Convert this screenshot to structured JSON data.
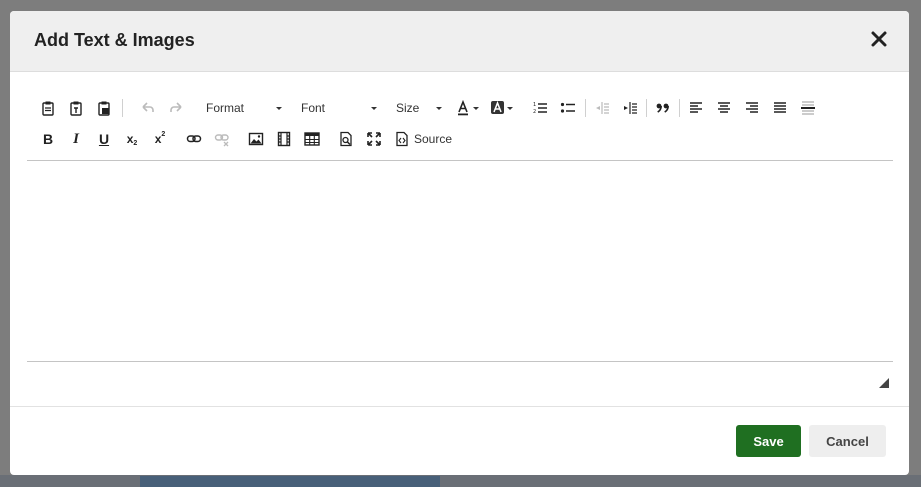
{
  "dialog": {
    "title": "Add Text & Images",
    "close_icon": "close-icon"
  },
  "toolbar": {
    "format_label": "Format",
    "font_label": "Font",
    "size_label": "Size",
    "source_label": "Source",
    "icons_row1": [
      "paste-icon",
      "paste-text-icon",
      "paste-word-icon",
      "undo-icon",
      "redo-icon",
      "text-color-icon",
      "background-color-icon",
      "numbered-list-icon",
      "bulleted-list-icon",
      "decrease-indent-icon",
      "increase-indent-icon",
      "blockquote-icon",
      "align-left-icon",
      "align-center-icon",
      "align-right-icon",
      "justify-icon",
      "horizontal-line-icon"
    ],
    "icons_row2": [
      "bold-icon",
      "italic-icon",
      "underline-icon",
      "subscript-icon",
      "superscript-icon",
      "link-icon",
      "unlink-icon",
      "image-icon",
      "video-icon",
      "table-icon",
      "preview-icon",
      "maximize-icon",
      "source-icon"
    ],
    "bold_label": "B",
    "italic_label": "I",
    "underline_label": "U",
    "subscript_label": "x",
    "superscript_label": "x"
  },
  "footer": {
    "save_label": "Save",
    "cancel_label": "Cancel"
  },
  "colors": {
    "save_bg": "#1f6f21",
    "cancel_bg": "#eeeeee",
    "header_bg": "#efefef"
  }
}
